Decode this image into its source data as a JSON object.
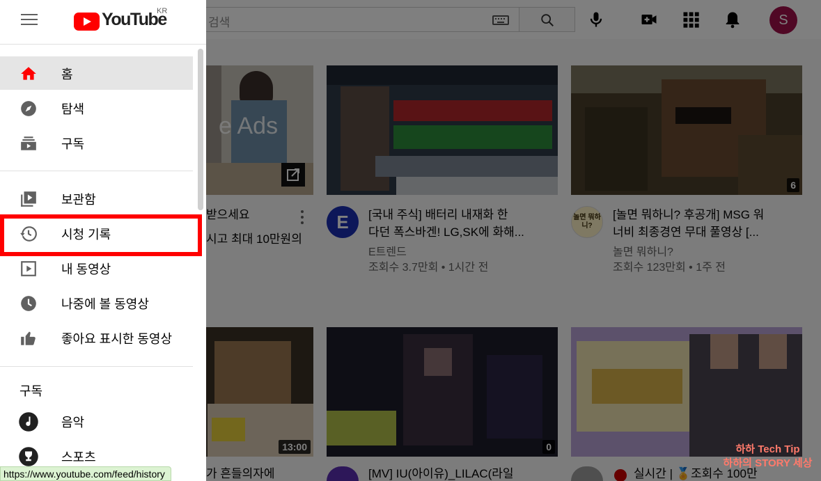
{
  "header": {
    "search_placeholder": "검색",
    "avatar_letter": "S",
    "region": "KR",
    "logo_text": "YouTube"
  },
  "drawer": {
    "primary": [
      {
        "label": "홈",
        "icon": "home-icon",
        "active": true
      },
      {
        "label": "탐색",
        "icon": "compass-icon"
      },
      {
        "label": "구독",
        "icon": "subscriptions-icon"
      }
    ],
    "library": [
      {
        "label": "보관함",
        "icon": "library-icon"
      },
      {
        "label": "시청 기록",
        "icon": "history-icon"
      },
      {
        "label": "내 동영상",
        "icon": "play-square-icon"
      },
      {
        "label": "나중에 볼 동영상",
        "icon": "clock-icon"
      },
      {
        "label": "좋아요 표시한 동영상",
        "icon": "thumbs-up-icon"
      }
    ],
    "subscriptions_title": "구독",
    "subscriptions": [
      {
        "label": "음악",
        "icon": "music-icon"
      },
      {
        "label": "스포츠",
        "icon": "trophy-icon"
      }
    ]
  },
  "videos": [
    {
      "title": "받으세요",
      "title2": "시고 최대 10만원의",
      "thumb_text": "e Ads"
    },
    {
      "title": "[국내 주식] 배터리 내재화 한",
      "title2": "다던 폭스바겐! LG,SK에 화해...",
      "channel": "E트렌드",
      "stats": "조회수 3.7만회 • 1시간 전",
      "avatar_letter": "E"
    },
    {
      "title": "[놀면 뭐하니? 후공개] MSG 워",
      "title2": "너비 최종경연 무대 풀영상 [...",
      "channel": "놀면 뭐하니?",
      "stats": "조회수 123만회 • 1주 전",
      "avatar_letter": "놀면 뭐하니?",
      "duration": "6"
    },
    {
      "title": "가 흔들의자에",
      "duration": "13:00"
    },
    {
      "title": "[MV] IU(아이유)_LILAC(라일",
      "duration": "0"
    },
    {
      "title": "실시간 | 🏅조회수 100만"
    }
  ],
  "status_url": "https://www.youtube.com/feed/history",
  "watermark": {
    "line1": "하하 Tech Tip",
    "line2": "하하의 STORY 세상"
  },
  "colors": {
    "brand_red": "#ff0000",
    "highlight_box": "#ff0000",
    "avatar_bg": "#a0114b",
    "channel_e_bg": "#1a2fb3"
  }
}
